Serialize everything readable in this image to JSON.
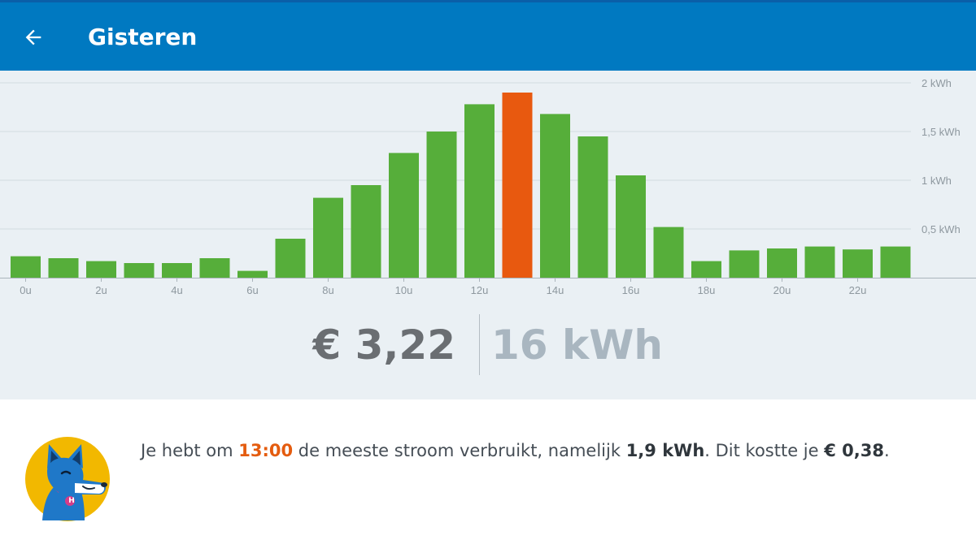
{
  "header": {
    "title": "Gisteren",
    "back_icon": "arrow-left-icon"
  },
  "colors": {
    "appbar": "#0079c1",
    "bar": "#56ae3a",
    "highlight_bar": "#e8590f",
    "chart_bg": "#eaf0f4"
  },
  "chart_data": {
    "type": "bar",
    "title": "",
    "xlabel": "",
    "ylabel": "",
    "y_unit": "kWh",
    "ylim": [
      0,
      2
    ],
    "yticks": [
      0.5,
      1,
      1.5,
      2
    ],
    "ytick_labels": [
      "0,5 kWh",
      "1 kWh",
      "1,5 kWh",
      "2 kWh"
    ],
    "grid": true,
    "categories": [
      "0u",
      "1u",
      "2u",
      "3u",
      "4u",
      "5u",
      "6u",
      "7u",
      "8u",
      "9u",
      "10u",
      "11u",
      "12u",
      "13u",
      "14u",
      "15u",
      "16u",
      "17u",
      "18u",
      "19u",
      "20u",
      "21u",
      "22u",
      "23u"
    ],
    "xtick_labels_shown": [
      "0u",
      "2u",
      "4u",
      "6u",
      "8u",
      "10u",
      "12u",
      "14u",
      "16u",
      "18u",
      "20u",
      "22u"
    ],
    "values": [
      0.22,
      0.2,
      0.17,
      0.15,
      0.15,
      0.2,
      0.07,
      0.4,
      0.82,
      0.95,
      1.28,
      1.5,
      1.78,
      1.9,
      1.68,
      1.45,
      1.05,
      0.52,
      0.17,
      0.28,
      0.3,
      0.32,
      0.29,
      0.32
    ],
    "highlight_index": 13
  },
  "totals": {
    "cost": "€ 3,22",
    "energy": "16 kWh"
  },
  "message": {
    "prefix": "Je hebt om ",
    "time": "13:00",
    "middle": " de meeste stroom verbruikt, namelijk ",
    "amount": "1,9 kWh",
    "after_amount": ". Dit kostte je ",
    "cost": "€ 0,38",
    "suffix": "."
  },
  "avatar": {
    "icon": "dog-mascot-icon",
    "tag_letter": "H"
  }
}
